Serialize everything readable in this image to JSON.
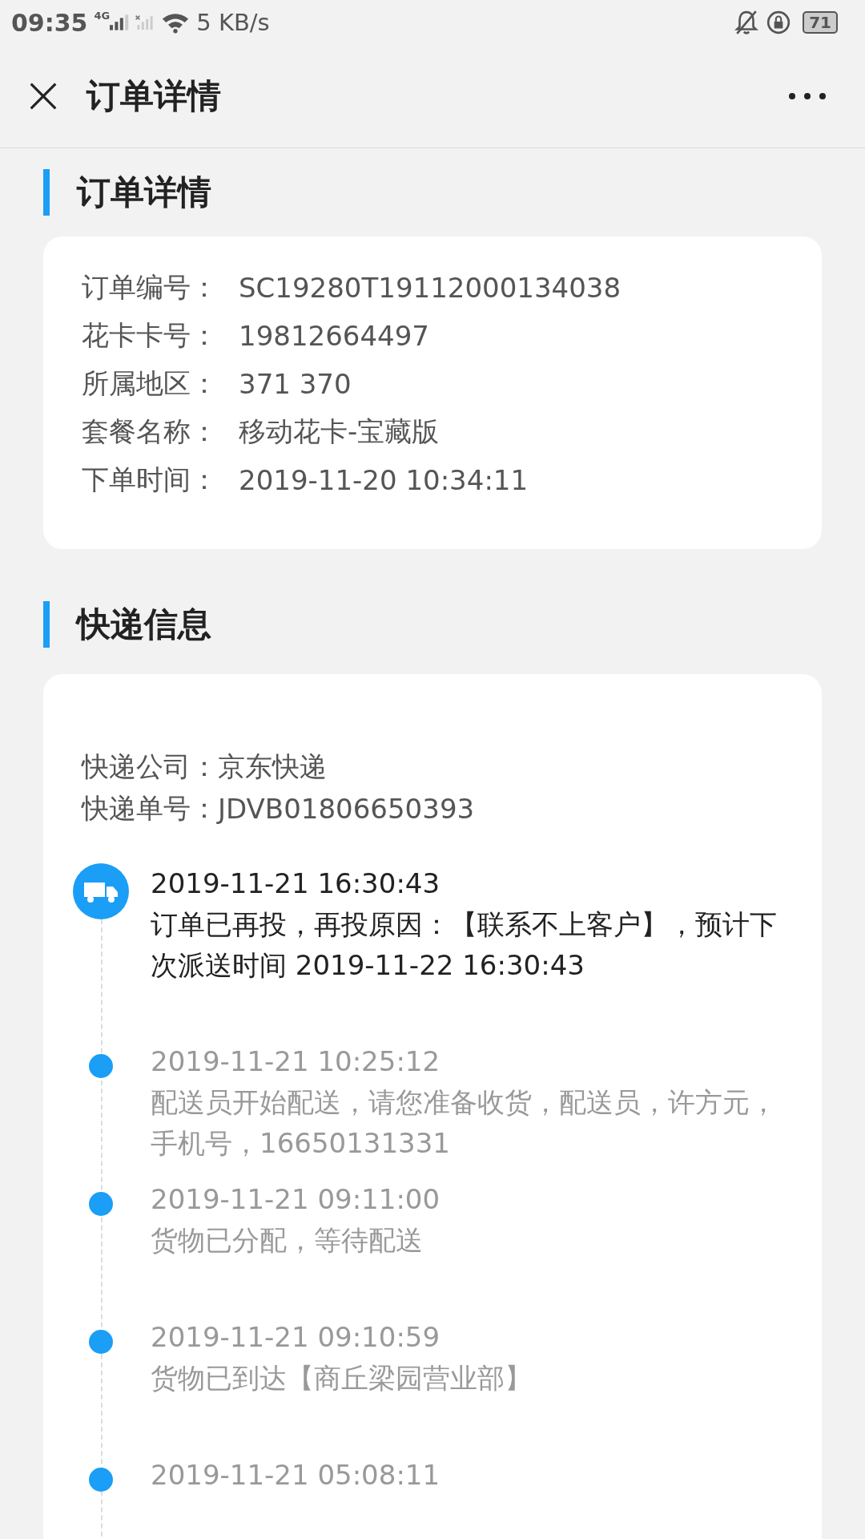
{
  "status_bar": {
    "time": "09:35",
    "network": "4G",
    "speed": "5 KB/s",
    "battery": "71"
  },
  "header": {
    "title": "订单详情"
  },
  "order_section": {
    "title": "订单详情",
    "fields": [
      {
        "label": "订单编号：",
        "value": "SC19280T19112000134038"
      },
      {
        "label": "花卡卡号：",
        "value": "19812664497"
      },
      {
        "label": "所属地区：",
        "value": "371 370"
      },
      {
        "label": "套餐名称：",
        "value": "移动花卡-宝藏版"
      },
      {
        "label": "下单时间：",
        "value": "2019-11-20 10:34:11"
      }
    ]
  },
  "shipping_section": {
    "title": "快递信息",
    "fields": [
      {
        "label": "快递公司：",
        "value": "京东快递"
      },
      {
        "label": "快递单号：",
        "value": "JDVB01806650393"
      }
    ],
    "events": [
      {
        "kind": "latest",
        "time": "2019-11-21 16:30:43",
        "text": "订单已再投，再投原因：【联系不上客户】，预计下次派送时间 2019-11-22 16:30:43"
      },
      {
        "kind": "past",
        "time": "2019-11-21 10:25:12",
        "text": "配送员开始配送，请您准备收货，配送员，许方元，手机号，16650131331"
      },
      {
        "kind": "past",
        "time": "2019-11-21 09:11:00",
        "text": "货物已分配，等待配送"
      },
      {
        "kind": "past",
        "time": "2019-11-21 09:10:59",
        "text": "货物已到达【商丘梁园营业部】"
      },
      {
        "kind": "past",
        "time": "2019-11-21 05:08:11"
      }
    ]
  }
}
